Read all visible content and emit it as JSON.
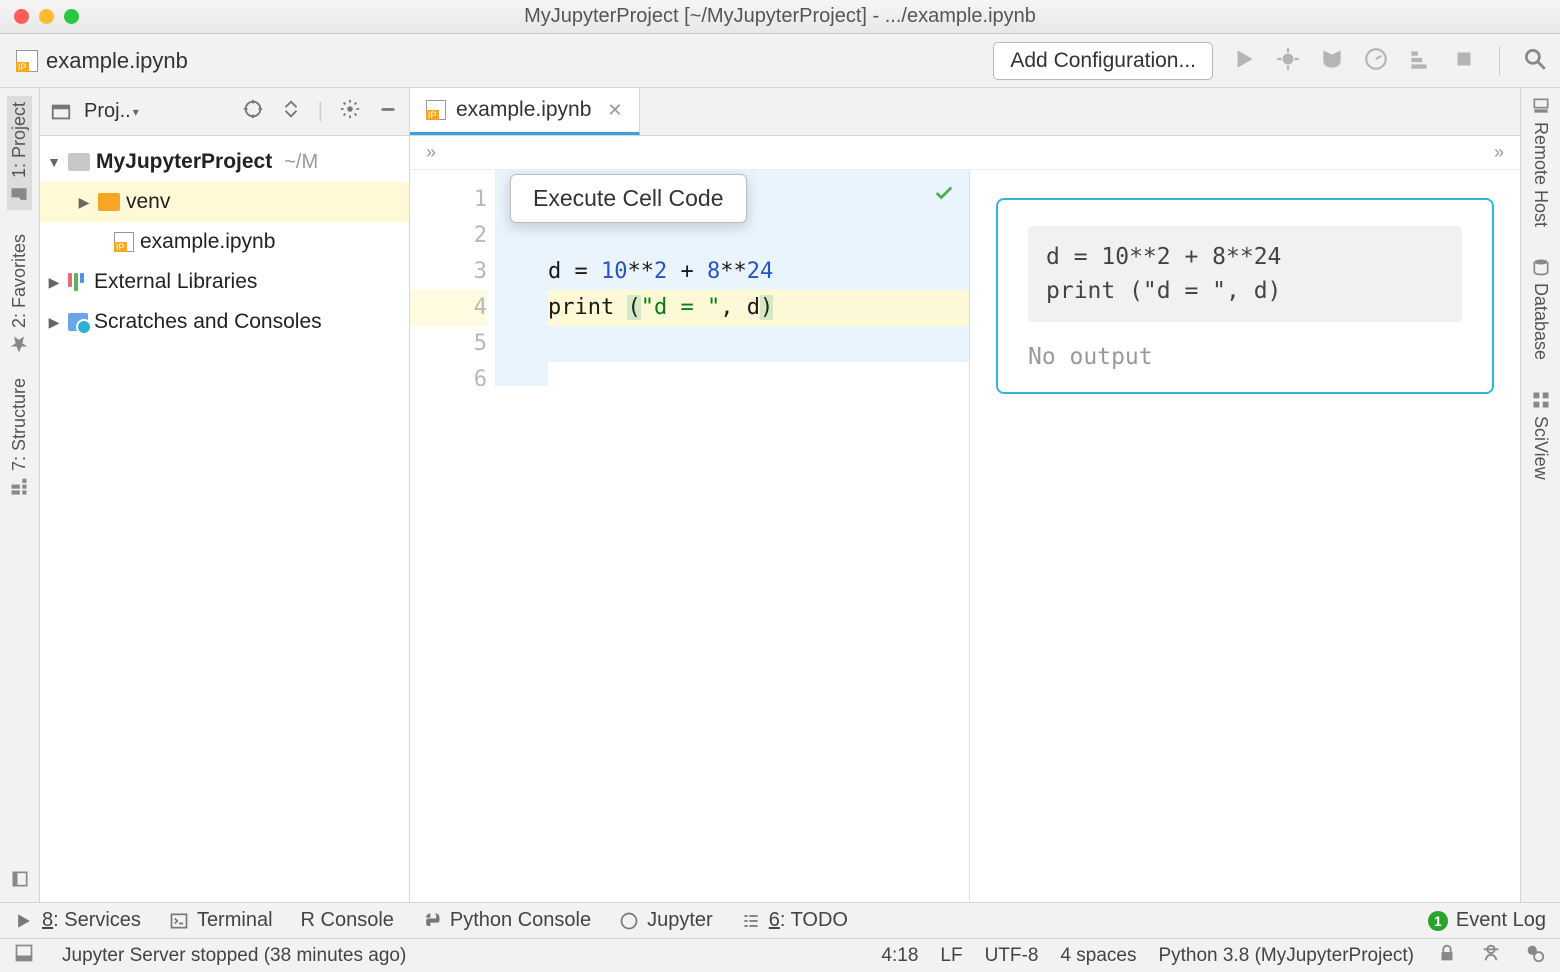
{
  "window": {
    "title": "MyJupyterProject [~/MyJupyterProject] - .../example.ipynb"
  },
  "top": {
    "file_tab": "example.ipynb",
    "add_config": "Add Configuration..."
  },
  "left_rail": {
    "project": "1: Project",
    "favorites": "2: Favorites",
    "structure": "7: Structure"
  },
  "right_rail": {
    "remote": "Remote Host",
    "database": "Database",
    "sciview": "SciView"
  },
  "project_panel": {
    "title": "Proj..",
    "root_name": "MyJupyterProject",
    "root_path": "~/M",
    "venv": "venv",
    "notebook": "example.ipynb",
    "ext_libs": "External Libraries",
    "scratches": "Scratches and Consoles"
  },
  "editor": {
    "tab_label": "example.ipynb",
    "tooltip": "Execute Cell Code",
    "breadcrumb_left": "»",
    "breadcrumb_right": "»",
    "gutter": [
      "1",
      "2",
      "3",
      "4",
      "5",
      "6"
    ],
    "code": {
      "l3_a": "d = ",
      "l3_n1": "10",
      "l3_b": "**",
      "l3_n2": "2",
      "l3_c": " + ",
      "l3_n3": "8",
      "l3_d": "**",
      "l3_n4": "24",
      "l4_a": "print ",
      "l4_p1": "(",
      "l4_s": "\"d = \"",
      "l4_b": ", d",
      "l4_p2": ")"
    }
  },
  "preview": {
    "code_text": "d = 10**2 + 8**24\nprint (\"d = \", d)",
    "no_output": "No output"
  },
  "bottom1": {
    "services": "8: Services",
    "terminal": "Terminal",
    "r_console": "R Console",
    "py_console": "Python Console",
    "jupyter": "Jupyter",
    "todo": "6: TODO",
    "event_log": "Event Log",
    "event_count": "1"
  },
  "bottom2": {
    "status_msg": "Jupyter Server stopped (38 minutes ago)",
    "caret": "4:18",
    "lf": "LF",
    "enc": "UTF-8",
    "indent": "4 spaces",
    "interpreter": "Python 3.8 (MyJupyterProject)"
  }
}
